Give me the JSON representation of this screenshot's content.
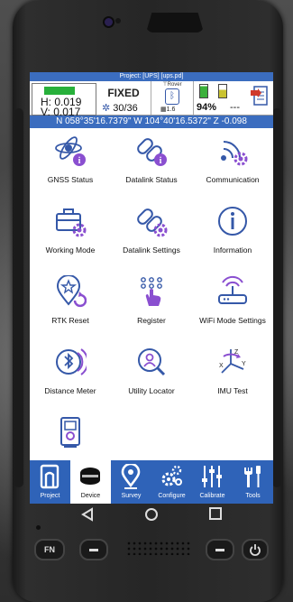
{
  "project_title": "Project: [UPS] [ups.pd]",
  "status": {
    "h": "H: 0.019",
    "v": "V: 0.017",
    "fix": "FIXED",
    "sats": "30/36",
    "rover": "Rover",
    "dop": "1.6",
    "battery": "94%",
    "battery2": "---"
  },
  "coords": "N 058°35'16.7379\"  W 104°40'16.5372\"  Z -0.098",
  "tiles": [
    {
      "label": "GNSS Status",
      "icon": "satellite-info-icon"
    },
    {
      "label": "Datalink Status",
      "icon": "link-settings-icon"
    },
    {
      "label": "Communication",
      "icon": "signal-settings-icon"
    },
    {
      "label": "Working Mode",
      "icon": "toolbox-settings-icon"
    },
    {
      "label": "Datalink Settings",
      "icon": "link-settings-icon"
    },
    {
      "label": "Information",
      "icon": "info-icon"
    },
    {
      "label": "RTK Reset",
      "icon": "pin-reset-icon"
    },
    {
      "label": "Register",
      "icon": "keypad-touch-icon"
    },
    {
      "label": "WiFi Mode Settings",
      "icon": "router-icon"
    },
    {
      "label": "Distance Meter",
      "icon": "bluetooth-meter-icon"
    },
    {
      "label": "Utility Locator",
      "icon": "search-person-icon"
    },
    {
      "label": "IMU Test",
      "icon": "axis-rotate-icon"
    }
  ],
  "nav": [
    {
      "label": "Project",
      "icon": "project-icon"
    },
    {
      "label": "Device",
      "icon": "receiver-icon",
      "active": true
    },
    {
      "label": "Survey",
      "icon": "location-icon"
    },
    {
      "label": "Configure",
      "icon": "gears-icon"
    },
    {
      "label": "Calibrate",
      "icon": "sliders-icon"
    },
    {
      "label": "Tools",
      "icon": "tools-icon"
    }
  ],
  "hardware_keys": {
    "fn": "FN"
  },
  "colors": {
    "primary": "#2f63b8",
    "accent": "#8a4fd0",
    "status_green": "#27b03a"
  }
}
